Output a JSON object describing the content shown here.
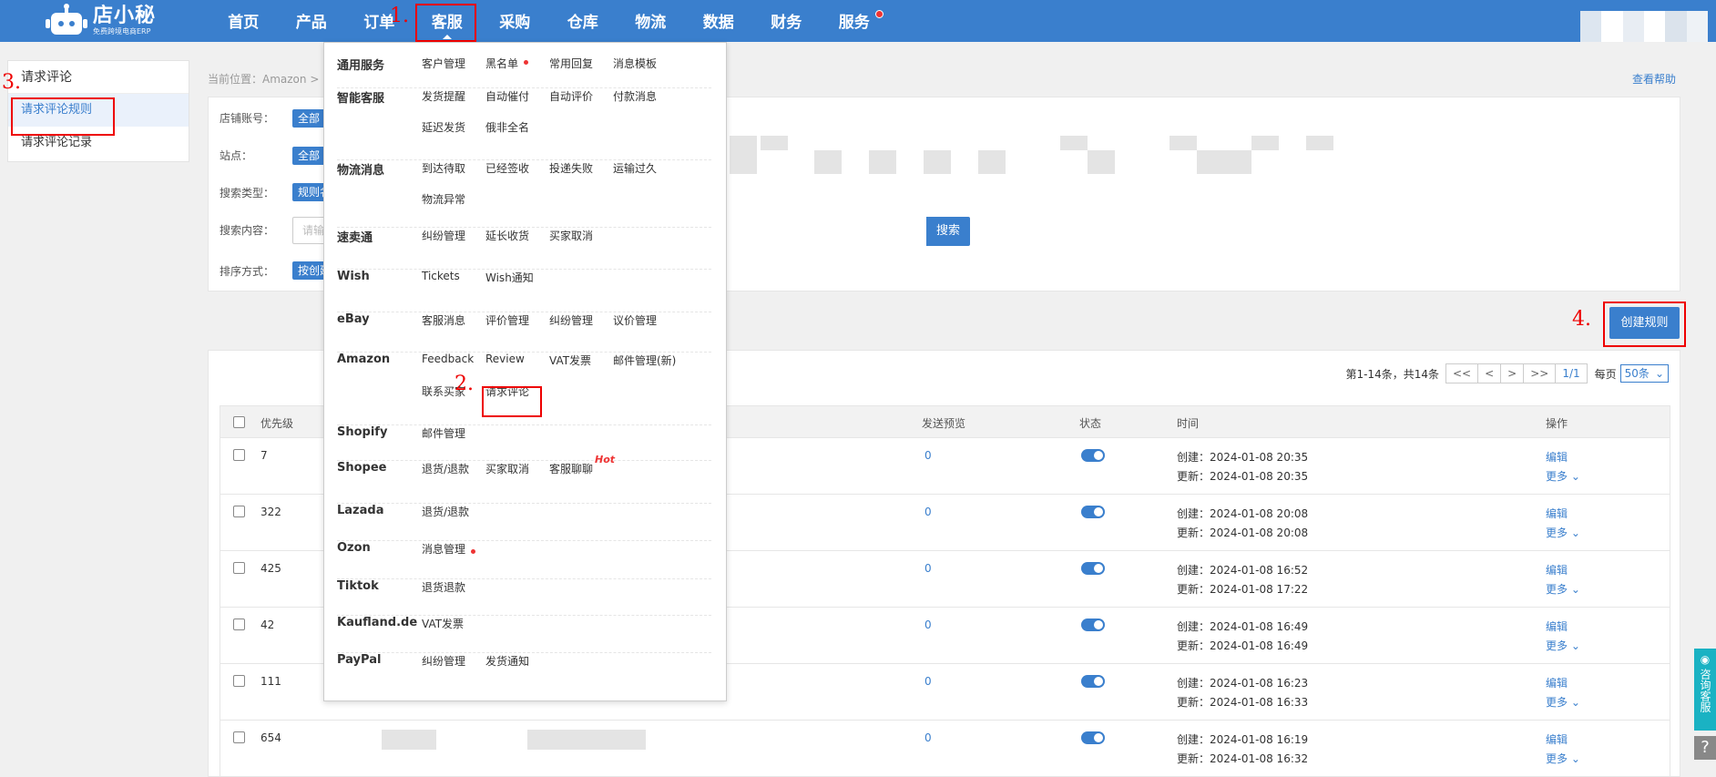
{
  "app": {
    "logo_name": "店小秘",
    "logo_sub": "免费跨境电商ERP"
  },
  "nav": [
    {
      "label": "首页"
    },
    {
      "label": "产品"
    },
    {
      "label": "订单"
    },
    {
      "label": "客服"
    },
    {
      "label": "采购"
    },
    {
      "label": "仓库"
    },
    {
      "label": "物流"
    },
    {
      "label": "数据"
    },
    {
      "label": "财务"
    },
    {
      "label": "服务"
    }
  ],
  "sidebar": {
    "title": "请求评论",
    "items": [
      {
        "label": "请求评论规则"
      },
      {
        "label": "请求评论记录"
      }
    ]
  },
  "breadcrumb": "当前位置：Amazon >",
  "help": "查看帮助",
  "filter": {
    "shop_label": "店铺账号：",
    "shop_value": "全部",
    "site_label": "站点：",
    "site_value": "全部",
    "type_label": "搜索类型：",
    "type_value": "规则名",
    "content_label": "搜索内容：",
    "content_placeholder": "请输",
    "search_btn": "搜索",
    "sort_label": "排序方式：",
    "sort_value": "按创建"
  },
  "create_button": "创建规则",
  "pagination": {
    "summary": "第1-14条，共14条",
    "first": "<<",
    "prev": "<",
    "next": ">",
    "last": ">>",
    "page": "1/1",
    "per_page_label": "每页",
    "per_page": "50条"
  },
  "table": {
    "headers": {
      "priority": "优先级",
      "preview": "发送预览",
      "status": "状态",
      "time": "时间",
      "actions": "操作"
    },
    "rows": [
      {
        "priority": "7",
        "preview": "0",
        "created": "创建：2024-01-08 20:35",
        "updated": "更新：2024-01-08 20:35",
        "edit": "编辑",
        "more": "更多"
      },
      {
        "priority": "322",
        "preview": "0",
        "created": "创建：2024-01-08 20:08",
        "updated": "更新：2024-01-08 20:08",
        "edit": "编辑",
        "more": "更多"
      },
      {
        "priority": "425",
        "preview": "0",
        "created": "创建：2024-01-08 16:52",
        "updated": "更新：2024-01-08 17:22",
        "edit": "编辑",
        "more": "更多"
      },
      {
        "priority": "42",
        "preview": "0",
        "created": "创建：2024-01-08 16:49",
        "updated": "更新：2024-01-08 16:49",
        "edit": "编辑",
        "more": "更多"
      },
      {
        "priority": "111",
        "preview": "0",
        "created": "创建：2024-01-08 16:23",
        "updated": "更新：2024-01-08 16:33",
        "edit": "编辑",
        "more": "更多"
      },
      {
        "priority": "654",
        "preview": "0",
        "created": "创建：2024-01-08 16:19",
        "updated": "更新：2024-01-08 16:32",
        "edit": "编辑",
        "more": "更多"
      }
    ]
  },
  "dropdown": [
    {
      "title": "通用服务",
      "links": [
        "客户管理",
        "黑名单",
        "常用回复",
        "消息模板"
      ]
    },
    {
      "title": "智能客服",
      "links": [
        "发货提醒",
        "自动催付",
        "自动评价",
        "付款消息",
        "延迟发货",
        "俄非全名"
      ]
    },
    {
      "title": "物流消息",
      "links": [
        "到达待取",
        "已经签收",
        "投递失败",
        "运输过久",
        "物流异常"
      ]
    },
    {
      "title": "速卖通",
      "links": [
        "纠纷管理",
        "延长收货",
        "买家取消"
      ]
    },
    {
      "title": "Wish",
      "links": [
        "Tickets",
        "Wish通知"
      ]
    },
    {
      "title": "eBay",
      "links": [
        "客服消息",
        "评价管理",
        "纠纷管理",
        "议价管理"
      ]
    },
    {
      "title": "Amazon",
      "links": [
        "Feedback",
        "Review",
        "VAT发票",
        "邮件管理(新)",
        "联系买家",
        "请求评论"
      ]
    },
    {
      "title": "Shopify",
      "links": [
        "邮件管理"
      ]
    },
    {
      "title": "Shopee",
      "links": [
        "退货/退款",
        "买家取消",
        "客服聊聊"
      ],
      "hot": "Hot"
    },
    {
      "title": "Lazada",
      "links": [
        "退货/退款"
      ]
    },
    {
      "title": "Ozon",
      "links": [
        "消息管理"
      ]
    },
    {
      "title": "Tiktok",
      "links": [
        "退货退款"
      ]
    },
    {
      "title": "Kaufland.de",
      "links": [
        "VAT发票"
      ]
    },
    {
      "title": "PayPal",
      "links": [
        "纠纷管理",
        "发货通知"
      ]
    }
  ],
  "annotations": [
    "1.",
    "2.",
    "3.",
    "4."
  ],
  "float": {
    "consult": "咨询客服",
    "help": "?"
  },
  "colors": {
    "primary": "#3a7fcd",
    "annotation": "#e00000",
    "float": "#1ab2c3"
  }
}
